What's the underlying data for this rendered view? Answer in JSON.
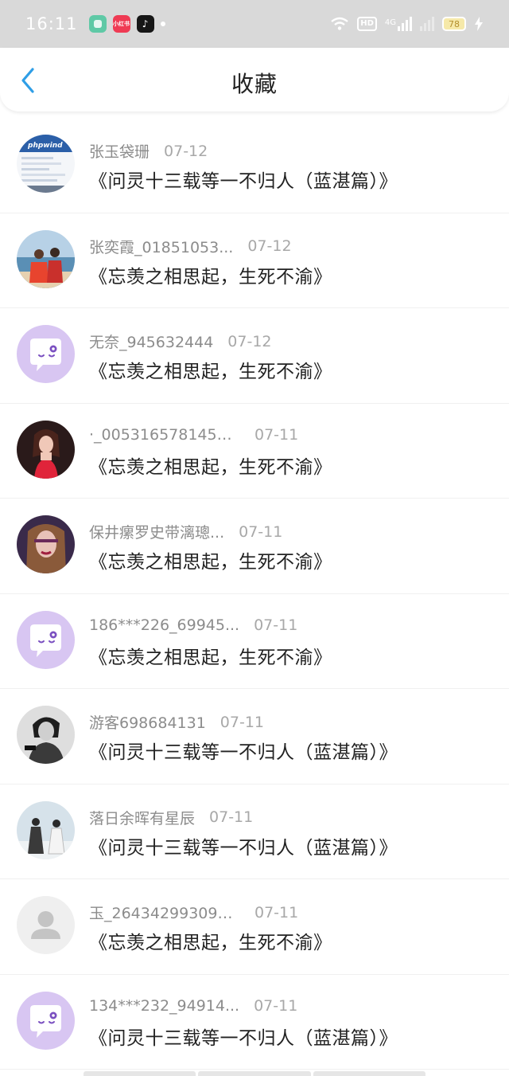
{
  "status_bar": {
    "time": "16:11",
    "apps": [
      {
        "name": "green-app-icon",
        "label": ""
      },
      {
        "name": "xiaohongshu-icon",
        "label": "小红书"
      },
      {
        "name": "tiktok-icon",
        "label": "♪"
      }
    ],
    "network": "4G",
    "hd": "HD",
    "battery": "78"
  },
  "header": {
    "title": "收藏"
  },
  "favorites": [
    {
      "user": "张玉袋珊",
      "date": "07-12",
      "book": "《问灵十三载等一不归人（蓝湛篇）》",
      "avatar": "screenshot"
    },
    {
      "user": "张奕霞_01851053...",
      "date": "07-12",
      "book": "《忘羡之相思起，生死不渝》",
      "avatar": "beach-photo"
    },
    {
      "user": "无奈_945632444",
      "date": "07-12",
      "book": "《忘羡之相思起，生死不渝》",
      "avatar": "default-chat"
    },
    {
      "user": "·_0053165781457...",
      "date": "07-11",
      "book": "《忘羡之相思起，生死不渝》",
      "avatar": "girl-red"
    },
    {
      "user": "保井瘰罗史带漓璁...",
      "date": "07-11",
      "book": "《忘羡之相思起，生死不渝》",
      "avatar": "girl-purple"
    },
    {
      "user": "186***226_69945...",
      "date": "07-11",
      "book": "《忘羡之相思起，生死不渝》",
      "avatar": "default-chat"
    },
    {
      "user": "游客698684131",
      "date": "07-11",
      "book": "《问灵十三载等一不归人（蓝湛篇）》",
      "avatar": "bw-portrait"
    },
    {
      "user": "落日余晖有星辰",
      "date": "07-11",
      "book": "《问灵十三载等一不归人（蓝湛篇）》",
      "avatar": "ancient-figures"
    },
    {
      "user": "玉_264342993091...",
      "date": "07-11",
      "book": "《忘羡之相思起，生死不渝》",
      "avatar": "default-person"
    },
    {
      "user": "134***232_94914...",
      "date": "07-11",
      "book": "《问灵十三载等一不归人（蓝湛篇）》",
      "avatar": "default-chat"
    }
  ],
  "colors": {
    "accent": "#2f9ee6",
    "default_avatar_bg": "#d8c6f2",
    "status_bar_bg": "#d9d9d9"
  }
}
